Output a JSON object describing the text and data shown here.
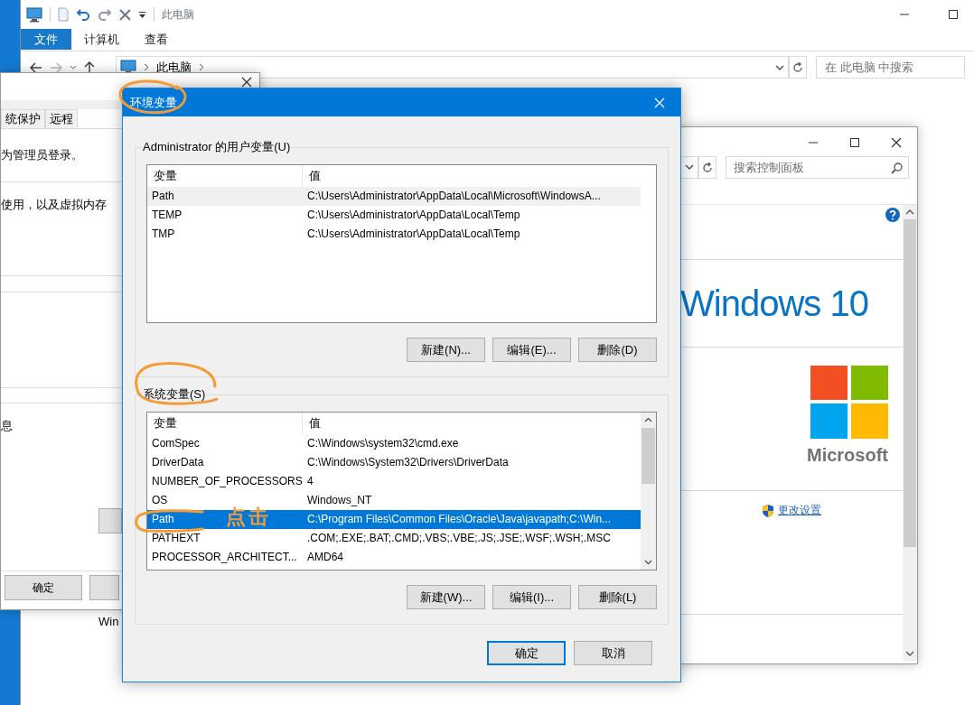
{
  "explorer": {
    "title": "此电脑",
    "ribbon_tabs": [
      {
        "label": "文件",
        "selected": true
      },
      {
        "label": "计算机",
        "selected": false
      },
      {
        "label": "查看",
        "selected": false
      }
    ],
    "address": [
      "此电脑"
    ],
    "search": {
      "placeholder": "在 此电脑 中搜索"
    },
    "body_text": "Win"
  },
  "system_properties": {
    "tabs": [
      {
        "label": "统保护",
        "selected": false
      },
      {
        "label": "远程",
        "selected": false
      }
    ],
    "texts": [
      "为管理员登录。",
      "使用，以及虚拟内存",
      "息"
    ],
    "buttons": [
      "确定"
    ]
  },
  "control_panel": {
    "search": {
      "placeholder": "搜索控制面板"
    },
    "edition": "Windows 10",
    "logo_text": "Microsoft",
    "link": "更改设置"
  },
  "environment_variables": {
    "title": "环境变量",
    "groups": [
      {
        "label": "Administrator 的用户变量(U)",
        "focused": false,
        "columns": [
          "变量",
          "值"
        ],
        "rows": [
          {
            "name": "Path",
            "value": "C:\\Users\\Administrator\\AppData\\Local\\Microsoft\\WindowsA...",
            "selected": true
          },
          {
            "name": "TEMP",
            "value": "C:\\Users\\Administrator\\AppData\\Local\\Temp",
            "selected": false
          },
          {
            "name": "TMP",
            "value": "C:\\Users\\Administrator\\AppData\\Local\\Temp",
            "selected": false
          }
        ],
        "buttons": [
          "新建(N)...",
          "编辑(E)...",
          "删除(D)"
        ]
      },
      {
        "label": "系统变量(S)",
        "focused": true,
        "columns": [
          "变量",
          "值"
        ],
        "rows": [
          {
            "name": "ComSpec",
            "value": "C:\\Windows\\system32\\cmd.exe",
            "selected": false
          },
          {
            "name": "DriverData",
            "value": "C:\\Windows\\System32\\Drivers\\DriverData",
            "selected": false
          },
          {
            "name": "NUMBER_OF_PROCESSORS",
            "value": "4",
            "selected": false
          },
          {
            "name": "OS",
            "value": "Windows_NT",
            "selected": false
          },
          {
            "name": "Path",
            "value": "C:\\Program Files\\Common Files\\Oracle\\Java\\javapath;C:\\Win...",
            "selected": true
          },
          {
            "name": "PATHEXT",
            "value": ".COM;.EXE;.BAT;.CMD;.VBS;.VBE;.JS;.JSE;.WSF;.WSH;.MSC",
            "selected": false
          },
          {
            "name": "PROCESSOR_ARCHITECT...",
            "value": "AMD64",
            "selected": false
          }
        ],
        "buttons": [
          "新建(W)...",
          "编辑(I)...",
          "删除(L)"
        ]
      }
    ],
    "buttons": [
      {
        "label": "确定",
        "default": true
      },
      {
        "label": "取消",
        "default": false
      }
    ]
  },
  "annotation": {
    "label": "点击"
  }
}
